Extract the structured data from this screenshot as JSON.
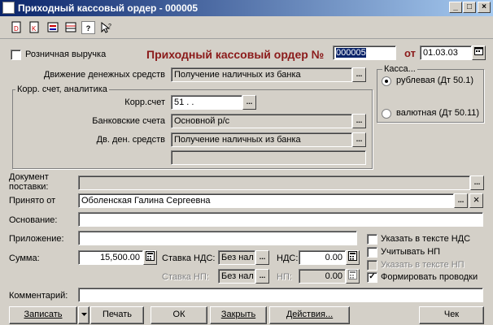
{
  "window": {
    "title": "Приходный кассовый ордер - 000005"
  },
  "header": {
    "retail_label": "Розничная выручка",
    "doc_heading": "Приходный кассовый ордер №",
    "doc_number": "000005",
    "date_from_label": "от",
    "date": "01.03.03"
  },
  "cash_group": {
    "title": "Касса...",
    "options": [
      {
        "label": "рублевая (Дт 50.1)",
        "selected": true
      },
      {
        "label": "валютная (Дт 50.11)",
        "selected": false
      }
    ]
  },
  "movement": {
    "label": "Движение денежных средств",
    "value": "Получение наличных из банка"
  },
  "corr_group": {
    "title": "Корр. счет, аналитика",
    "corr_label": "Корр.счет",
    "corr_value": "51 . .",
    "bank_label": "Банковские счета",
    "bank_value": "Основной р/с",
    "cash_flow_label": "Дв. ден. средств",
    "cash_flow_value": "Получение наличных из банка",
    "extra_value": ""
  },
  "form": {
    "supply_doc_label_1": "Документ",
    "supply_doc_label_2": "поставки:",
    "supply_doc_value": "",
    "received_from_label": "Принято от",
    "received_from_value": "Оболенская Галина Сергеевна",
    "basis_label": "Основание:",
    "basis_value": "",
    "attachment_label": "Приложение:",
    "attachment_value": "",
    "sum_label": "Сумма:",
    "sum_value": "15,500.00",
    "vat_rate_label": "Ставка НДС:",
    "vat_rate_value": "Без нал",
    "vat_label": "НДС:",
    "vat_value": "0.00",
    "np_rate_label": "Ставка НП:",
    "np_rate_value": "Без нал",
    "np_label": "НП:",
    "np_value": "0.00",
    "comment_label": "Комментарий:",
    "comment_value": ""
  },
  "checkboxes": {
    "vat_in_text": {
      "label": "Указать в тексте НДС",
      "checked": false
    },
    "consider_np": {
      "label": "Учитывать НП",
      "checked": false
    },
    "np_in_text": {
      "label": "Указать в тексте НП",
      "checked": false
    },
    "make_entries": {
      "label": "Формировать проводки",
      "checked": true
    }
  },
  "buttons": {
    "write": "Записать",
    "print": "Печать",
    "ok": "ОК",
    "close": "Закрыть",
    "actions": "Действия...",
    "check": "Чек"
  },
  "icons": {
    "ellipsis": "...",
    "clear": "×",
    "check": "✓"
  }
}
